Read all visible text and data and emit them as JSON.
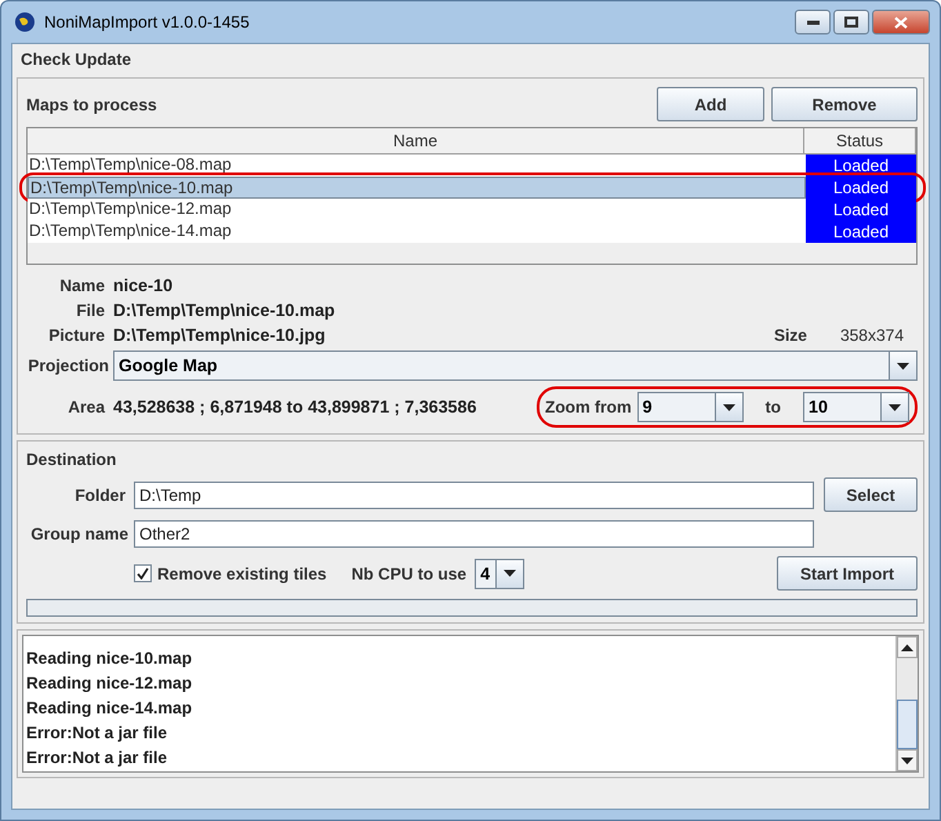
{
  "window": {
    "title": "NoniMapImport v1.0.0-1455"
  },
  "menu": [
    "Check Update"
  ],
  "maps": {
    "title": "Maps to process",
    "buttons": [
      "Add",
      "Remove"
    ],
    "columns": [
      "Name",
      "Status"
    ],
    "rows": [
      {
        "name": "D:\\Temp\\Temp\\nice-08.map",
        "status": "Loaded",
        "selected": false,
        "circled": false
      },
      {
        "name": "D:\\Temp\\Temp\\nice-10.map",
        "status": "Loaded",
        "selected": true,
        "circled": true
      },
      {
        "name": "D:\\Temp\\Temp\\nice-12.map",
        "status": "Loaded",
        "selected": false,
        "circled": false
      },
      {
        "name": "D:\\Temp\\Temp\\nice-14.map",
        "status": "Loaded",
        "selected": false,
        "circled": false
      }
    ]
  },
  "details": {
    "name_label": "Name",
    "name": "nice-10",
    "file_label": "File",
    "file": "D:\\Temp\\Temp\\nice-10.map",
    "picture_label": "Picture",
    "picture": "D:\\Temp\\Temp\\nice-10.jpg",
    "size_label": "Size",
    "size": "358x374",
    "projection_label": "Projection",
    "projection": "Google Map",
    "area_label": "Area",
    "area": "43,528638 ; 6,871948 to 43,899871 ; 7,363586",
    "zoom_label": "Zoom from",
    "zoom_from": "9",
    "zoom_to_label": "to",
    "zoom_to": "10",
    "zoom_circled": true
  },
  "destination": {
    "title": "Destination",
    "folder_label": "Folder",
    "folder": "D:\\Temp",
    "select_button": "Select",
    "group_label": "Group name",
    "group": "Other2",
    "remove_tiles": {
      "label": "Remove existing tiles",
      "checked": true
    },
    "cpu_label": "Nb CPU to use",
    "cpu": "4",
    "start_button": "Start Import",
    "progress": {
      "level": 0
    }
  },
  "log": [
    "Reading nice-10.map",
    "Reading nice-12.map",
    "Reading nice-14.map",
    "Error:Not a jar file",
    "Error:Not a jar file"
  ]
}
